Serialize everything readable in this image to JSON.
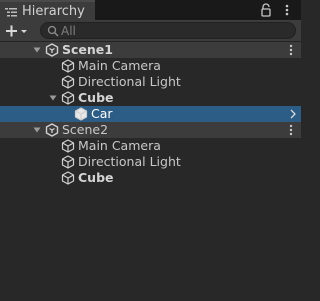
{
  "window": {
    "tab_title": "Hierarchy",
    "tab_icon": "hierarchy-list-icon",
    "lock_icon": "lock-icon",
    "menu_icon": "kebab-menu-icon"
  },
  "toolbar": {
    "add_icon": "plus-icon",
    "add_dropdown_icon": "caret-down-icon",
    "search_placeholder": "All",
    "search_icon": "search-icon"
  },
  "colors": {
    "panel_bg": "#282828",
    "scene_row_bg": "#3c3c3c",
    "selected_row_bg": "#2c5d87",
    "text": "#c8c8c8"
  },
  "tree": [
    {
      "label": "Scene1",
      "type": "scene",
      "expanded": true,
      "bold": true,
      "has_menu": true
    },
    {
      "label": "Main Camera",
      "type": "gameobject",
      "depth": 1
    },
    {
      "label": "Directional Light",
      "type": "gameobject",
      "depth": 1
    },
    {
      "label": "Cube",
      "type": "gameobject",
      "depth": 1,
      "expanded": true,
      "bold": true
    },
    {
      "label": "Car",
      "type": "gameobject",
      "depth": 2,
      "selected": true,
      "has_chevron": true
    },
    {
      "label": "Scene2",
      "type": "scene",
      "expanded": true,
      "bold": false,
      "has_menu": true
    },
    {
      "label": "Main Camera",
      "type": "gameobject",
      "depth": 1
    },
    {
      "label": "Directional Light",
      "type": "gameobject",
      "depth": 1
    },
    {
      "label": "Cube",
      "type": "gameobject",
      "depth": 1,
      "bold": true
    }
  ]
}
